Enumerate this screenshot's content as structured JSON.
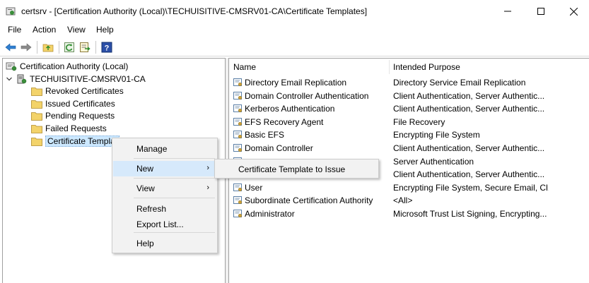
{
  "window": {
    "title": "certsrv - [Certification Authority (Local)\\TECHUISITIVE-CMSRV01-CA\\Certificate Templates]",
    "min_glyph": "—",
    "max_glyph": "☐",
    "close_glyph": "✕"
  },
  "menubar": {
    "items": [
      "File",
      "Action",
      "View",
      "Help"
    ]
  },
  "toolbar": {
    "icons": [
      "back-arrow-icon",
      "forward-arrow-icon",
      "up-folder-icon",
      "refresh-icon",
      "export-list-icon",
      "help-icon"
    ]
  },
  "tree": {
    "root": "Certification Authority (Local)",
    "ca": "TECHUISITIVE-CMSRV01-CA",
    "folders": [
      "Revoked Certificates",
      "Issued Certificates",
      "Pending Requests",
      "Failed Requests",
      "Certificate Templat"
    ],
    "selected_index": 4
  },
  "list": {
    "columns": [
      "Name",
      "Intended Purpose"
    ],
    "rows": [
      {
        "name": "Directory Email Replication",
        "purpose": "Directory Service Email Replication"
      },
      {
        "name": "Domain Controller Authentication",
        "purpose": "Client Authentication, Server Authentic..."
      },
      {
        "name": "Kerberos Authentication",
        "purpose": "Client Authentication, Server Authentic..."
      },
      {
        "name": "EFS Recovery Agent",
        "purpose": "File Recovery"
      },
      {
        "name": "Basic EFS",
        "purpose": "Encrypting File System"
      },
      {
        "name": "Domain Controller",
        "purpose": "Client Authentication, Server Authentic..."
      },
      {
        "name": "",
        "purpose": "Server Authentication"
      },
      {
        "name": "",
        "purpose": "Client Authentication, Server Authentic..."
      },
      {
        "name": "User",
        "purpose": "Encrypting File System, Secure Email, Cl..."
      },
      {
        "name": "Subordinate Certification Authority",
        "purpose": "<All>"
      },
      {
        "name": "Administrator",
        "purpose": "Microsoft Trust List Signing, Encrypting..."
      }
    ]
  },
  "context_menu": {
    "items": [
      {
        "label": "Manage",
        "arrow": ""
      },
      {
        "label": "New",
        "arrow": "›"
      },
      {
        "label": "View",
        "arrow": "›"
      },
      {
        "label": "Refresh",
        "arrow": ""
      },
      {
        "label": "Export List...",
        "arrow": ""
      },
      {
        "label": "Help",
        "arrow": ""
      }
    ],
    "highlighted": "New"
  },
  "submenu": {
    "item": "Certificate Template to Issue"
  },
  "colors": {
    "selection": "#cce8ff",
    "menu_highlight": "#d6e9fb",
    "folder_yellow": "#f3d36a",
    "arrow_blue": "#2f7fd1"
  }
}
